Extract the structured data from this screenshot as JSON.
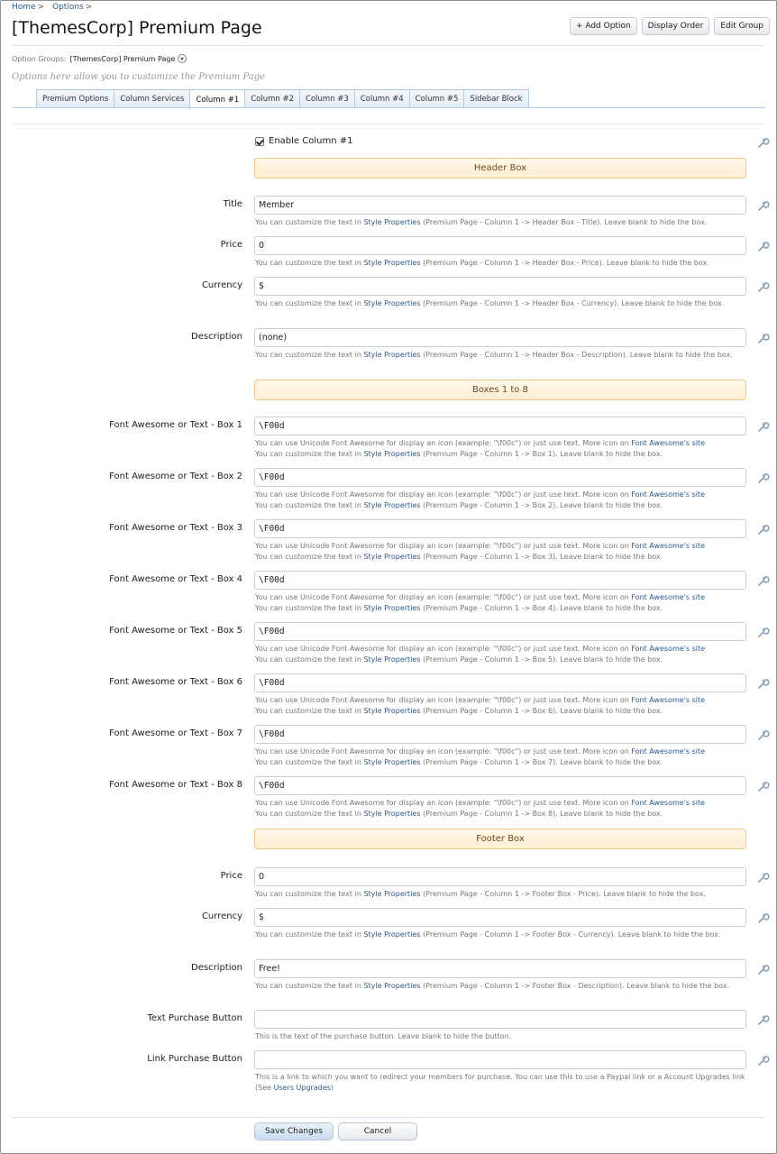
{
  "breadcrumb": [
    "Home",
    "Options"
  ],
  "page_title": "[ThemesCorp] Premium Page",
  "top_buttons": {
    "add_option": "+ Add Option",
    "display_order": "Display Order",
    "edit_group": "Edit Group"
  },
  "option_group": {
    "label": "Option Groups:",
    "value": "[ThemesCorp] Premium Page"
  },
  "group_description": "Options here allow you to customize the Premium Page",
  "tabs": [
    "Premium Options",
    "Column Services",
    "Column #1",
    "Column #2",
    "Column #3",
    "Column #4",
    "Column #5",
    "Sidebar Block"
  ],
  "active_tab": "Column #1",
  "enable_label": "Enable Column #1",
  "sections": {
    "header": "Header Box",
    "boxes": "Boxes 1 to 8",
    "footer": "Footer Box"
  },
  "links": {
    "style_properties": "Style Properties",
    "font_awesome_site": "Font Awesome's site",
    "users_upgrades": "Users Upgrades"
  },
  "hint_parts": {
    "customize_prefix": "You can customize the text in",
    "leave_blank_box": "Leave blank to hide the box.",
    "unicode_prefix": "You can use Unicode Font Awesome for display an icon (example: \"\\f00c\") or just use text. More icon on"
  },
  "header_fields": [
    {
      "label": "Title",
      "value": "Member",
      "path": "(Premium Page - Column 1 -> Header Box - Title)."
    },
    {
      "label": "Price",
      "value": "0",
      "path": "(Premium Page - Column 1 -> Header Box - Price)."
    },
    {
      "label": "Currency",
      "value": "$",
      "path": "(Premium Page - Column 1 -> Header Box - Currency)."
    },
    {
      "label": "Description",
      "value": "(none)",
      "path": "(Premium Page - Column 1 -> Header Box - Description)."
    }
  ],
  "box_fields": [
    {
      "label": "Font Awesome or Text - Box 1",
      "value": "\\F00d",
      "path": "(Premium Page - Column 1 -> Box 1)."
    },
    {
      "label": "Font Awesome or Text - Box 2",
      "value": "\\F00d",
      "path": "(Premium Page - Column 1 -> Box 2)."
    },
    {
      "label": "Font Awesome or Text - Box 3",
      "value": "\\F00d",
      "path": "(Premium Page - Column 1 -> Box 3)."
    },
    {
      "label": "Font Awesome or Text - Box 4",
      "value": "\\F00d",
      "path": "(Premium Page - Column 1 -> Box 4)."
    },
    {
      "label": "Font Awesome or Text - Box 5",
      "value": "\\F00d",
      "path": "(Premium Page - Column 1 -> Box 5)."
    },
    {
      "label": "Font Awesome or Text - Box 6",
      "value": "\\F00d",
      "path": "(Premium Page - Column 1 -> Box 6)."
    },
    {
      "label": "Font Awesome or Text - Box 7",
      "value": "\\F00d",
      "path": "(Premium Page - Column 1 -> Box 7)."
    },
    {
      "label": "Font Awesome or Text - Box 8",
      "value": "\\F00d",
      "path": "(Premium Page - Column 1 -> Box 8)."
    }
  ],
  "footer_fields": [
    {
      "label": "Price",
      "value": "0",
      "path": "(Premium Page - Column 1 -> Footer Box - Price)."
    },
    {
      "label": "Currency",
      "value": "$",
      "path": "(Premium Page - Column 1 -> Footer Box - Currency)."
    },
    {
      "label": "Description",
      "value": "Free!",
      "path": "(Premium Page - Column 1 -> Footer Box - Description)."
    }
  ],
  "purchase_text": {
    "label": "Text Purchase Button",
    "value": "",
    "hint": "This is the text of the purchase button. Leave blank to hide the button."
  },
  "purchase_link": {
    "label": "Link Purchase Button",
    "value": "",
    "hint_prefix": "This is a link to which you want to redirect your members for purchase. You can use this to use a Paypal link or a Account Upgrades link (See",
    "hint_suffix": ")"
  },
  "buttons": {
    "save": "Save Changes",
    "cancel": "Cancel"
  },
  "icons": {
    "edit": "wrench-icon"
  },
  "colors": {
    "link": "#2b5a8c",
    "section_bg": "#ffeed2",
    "section_border": "#f2c58a",
    "tab_border": "#b8cce0"
  }
}
